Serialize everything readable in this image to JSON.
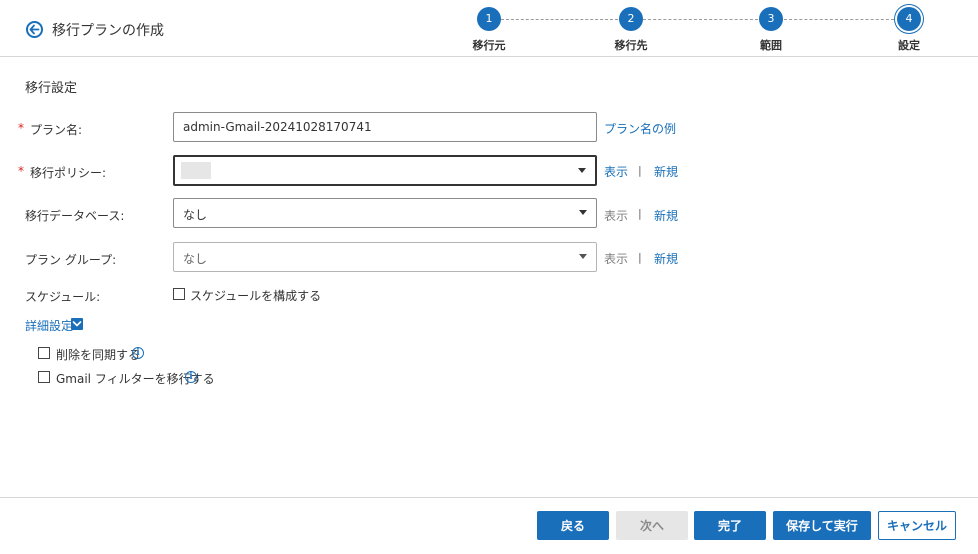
{
  "header": {
    "title": "移行プランの作成"
  },
  "stepper": {
    "steps": [
      {
        "number": "1",
        "label": "移行元"
      },
      {
        "number": "2",
        "label": "移行先"
      },
      {
        "number": "3",
        "label": "範囲"
      },
      {
        "number": "4",
        "label": "設定"
      }
    ],
    "current_step": 4
  },
  "form": {
    "section_title": "移行設定",
    "required_mark": "*",
    "plan_name": {
      "label": "プラン名:",
      "value": "admin-Gmail-20241028170741",
      "example_link": "プラン名の例"
    },
    "migration_policy": {
      "label": "移行ポリシー:",
      "value": "",
      "view_link": "表示",
      "separator": "|",
      "new_link": "新規"
    },
    "migration_database": {
      "label": "移行データベース:",
      "value": "なし",
      "view_link": "表示",
      "separator": "|",
      "new_link": "新規"
    },
    "plan_group": {
      "label": "プラン グループ:",
      "value": "なし",
      "view_link": "表示",
      "separator": "|",
      "new_link": "新規"
    },
    "schedule": {
      "label": "スケジュール:",
      "checkbox_label": "スケジュールを構成する",
      "checked": false
    },
    "advanced": {
      "label": "詳細設定",
      "sync_deletion": {
        "label": "削除を同期する",
        "checked": false
      },
      "migrate_gmail_filters": {
        "label": "Gmail フィルターを移行する",
        "checked": false
      }
    }
  },
  "footer": {
    "back_label": "戻る",
    "next_label": "次へ",
    "finish_label": "完了",
    "save_run_label": "保存して実行",
    "cancel_label": "キャンセル"
  },
  "colors": {
    "accent": "#1a6fba",
    "required": "#d9261c",
    "disabled_bg": "#e6e6e6"
  },
  "icons": {
    "back": "back-arrow-circle-icon",
    "info": "info-icon",
    "dropdown": "caret-down-icon",
    "advanced_toggle": "chevron-down-icon"
  }
}
